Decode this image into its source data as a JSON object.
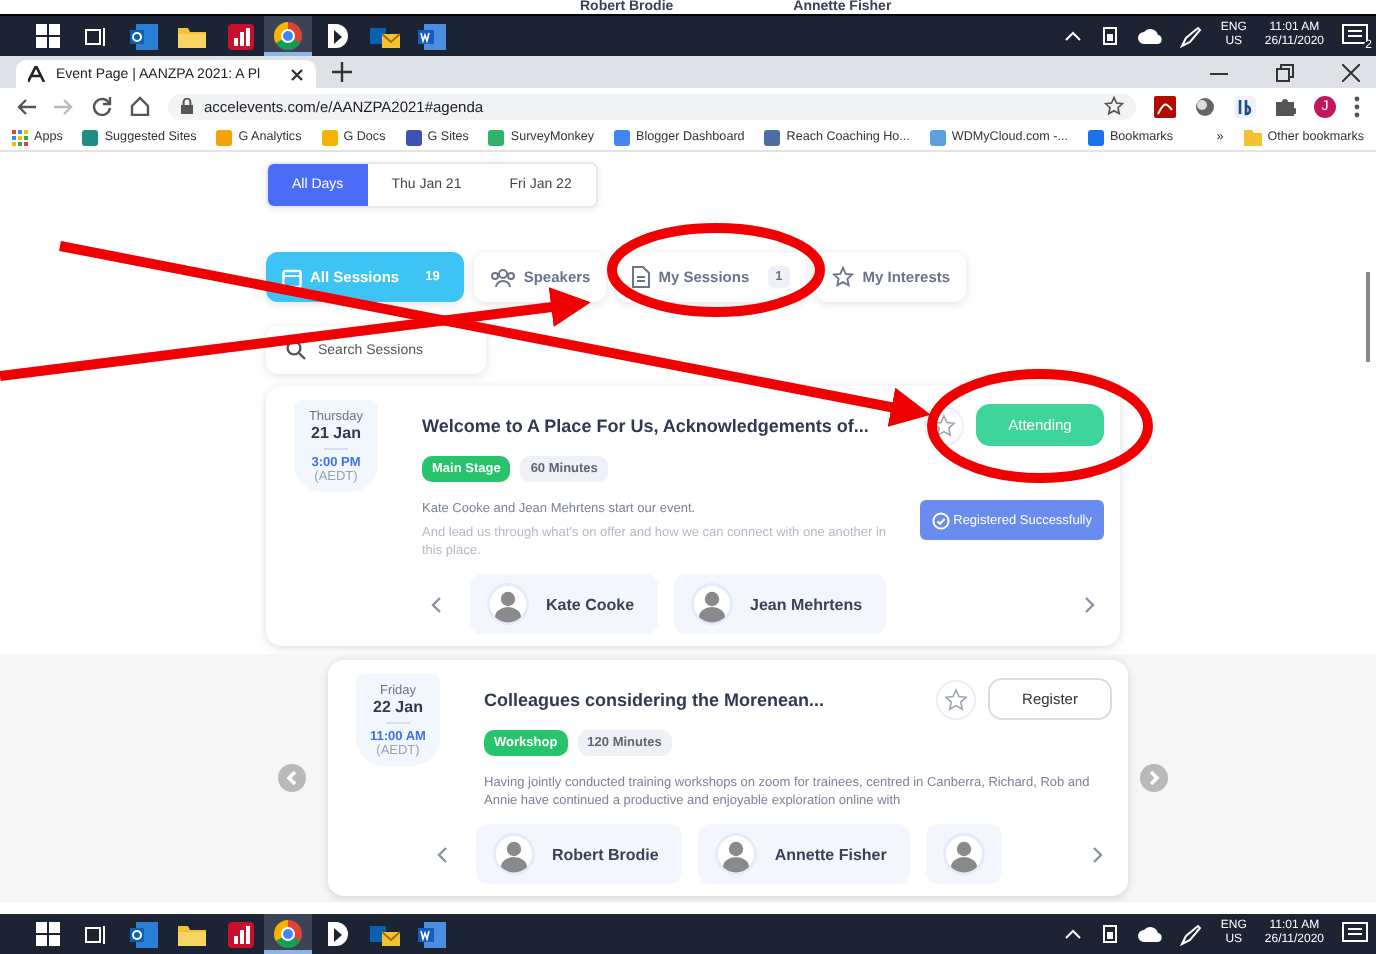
{
  "top_strip": {
    "speakers": [
      "Robert Brodie",
      "Annette Fisher"
    ]
  },
  "taskbars": [
    {
      "apps": [
        {
          "kind": "start",
          "selected": false
        },
        {
          "kind": "taskview",
          "selected": false
        },
        {
          "kind": "outlook",
          "selected": false
        },
        {
          "kind": "folder",
          "selected": false
        },
        {
          "kind": "chart",
          "selected": false
        },
        {
          "kind": "browser",
          "selected": true
        },
        {
          "kind": "app",
          "selected": false
        },
        {
          "kind": "mail",
          "selected": false
        },
        {
          "kind": "word",
          "selected": false
        }
      ],
      "lang": "ENG",
      "region": "US",
      "time": "11:01 AM",
      "date": "26/11/2020",
      "notifications": "2"
    },
    {
      "apps": [
        {
          "kind": "start",
          "selected": false
        },
        {
          "kind": "taskview",
          "selected": false
        },
        {
          "kind": "outlook",
          "selected": false
        },
        {
          "kind": "folder",
          "selected": false
        },
        {
          "kind": "chart",
          "selected": false
        },
        {
          "kind": "browser",
          "selected": true
        },
        {
          "kind": "app",
          "selected": false
        },
        {
          "kind": "mail",
          "selected": false
        },
        {
          "kind": "word",
          "selected": false
        }
      ],
      "lang": "ENG",
      "region": "US",
      "time": "11:01 AM",
      "date": "26/11/2020"
    }
  ],
  "browser": {
    "tab_title": "Event Page | AANZPA 2021: A Pl",
    "url": "accelevents.com/e/AANZPA2021#agenda",
    "profile": "J",
    "bookmarks": [
      "Apps",
      "Suggested Sites",
      "G Analytics",
      "G Docs",
      "G Sites",
      "SurveyMonkey",
      "Blogger Dashboard",
      "Reach Coaching Ho...",
      "WDMyCloud.com -...",
      "Bookmarks"
    ],
    "more": "»",
    "other_bookmarks": "Other bookmarks"
  },
  "day_tabs": [
    {
      "label": "All Days",
      "selected": true
    },
    {
      "label": "Thu Jan 21",
      "selected": false
    },
    {
      "label": "Fri Jan 22",
      "selected": false
    }
  ],
  "session_tabs": [
    {
      "kind": "calendar",
      "label": "All Sessions",
      "count": "19",
      "selected": true
    },
    {
      "kind": "people",
      "label": "Speakers",
      "selected": false
    },
    {
      "kind": "document",
      "label": "My Sessions",
      "count": "1",
      "selected": false
    },
    {
      "kind": "star",
      "label": "My Interests",
      "selected": false
    }
  ],
  "search": {
    "placeholder": "Search Sessions"
  },
  "sessions": [
    {
      "weekday": "Thursday",
      "date": "21 Jan",
      "time": "3:00 PM",
      "timezone": "(AEDT)",
      "title": "Welcome to A Place For Us, Acknowledgements of...",
      "tag": "Main Stage",
      "duration": "60 Minutes",
      "starred": false,
      "action": {
        "kind": "attending",
        "label": "Attending"
      },
      "status": "Registered Successfully",
      "description": [
        "Kate Cooke and Jean Mehrtens start our event.",
        "And lead us through what's on offer and how we can connect with one another in this place."
      ],
      "speakers": [
        {
          "name": "Kate Cooke"
        },
        {
          "name": "Jean Mehrtens"
        }
      ],
      "carousel": false
    },
    {
      "weekday": "Friday",
      "date": "22 Jan",
      "time": "11:00 AM",
      "timezone": "(AEDT)",
      "title": "Colleagues considering the Morenean...",
      "tag": "Workshop",
      "duration": "120 Minutes",
      "starred": false,
      "action": {
        "kind": "register",
        "label": "Register"
      },
      "description": [
        "Having jointly conducted training workshops on zoom for trainees, centred in Canberra, Richard, Rob and Annie have continued a productive and enjoyable exploration online with"
      ],
      "speakers": [
        {
          "name": "Robert Brodie"
        },
        {
          "name": "Annette Fisher"
        }
      ],
      "more_speakers": true,
      "carousel": true
    }
  ]
}
